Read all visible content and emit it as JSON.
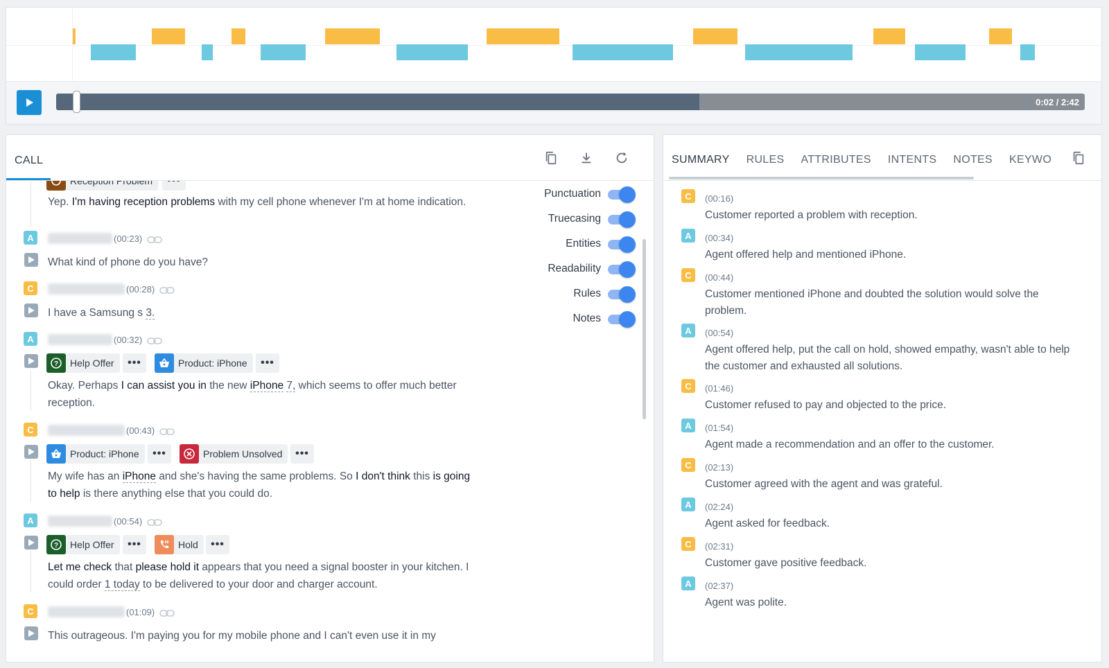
{
  "player": {
    "time": "0:02 / 2:42",
    "progress_fraction": 0.625,
    "handle_fraction": 0.016
  },
  "call": {
    "tab_label": "CALL",
    "partial_chip": "Reception Problem",
    "lines": {
      "l0": {
        "text_pre": "Yep. ",
        "text_bold": "I'm having reception problems",
        "text_post": " with my cell phone whenever I'm at home indication."
      },
      "l1": {
        "badge": "A",
        "time": "(00:23)",
        "text": "What kind of phone do you have?"
      },
      "l2": {
        "badge": "C",
        "time": "(00:28)",
        "text_pre": "I have a Samsung s ",
        "entity": "3."
      },
      "l3": {
        "badge": "A",
        "time": "(00:32)",
        "chip1": "Help Offer",
        "chip2": "Product: iPhone",
        "text_a": "Okay. Perhaps ",
        "text_b": "I can assist you in",
        "text_c": " the new ",
        "entity1": "iPhone",
        "text_d": " ",
        "entity2": "7,",
        "text_e": " which seems to offer much better reception."
      },
      "l4": {
        "badge": "C",
        "time": "(00:43)",
        "chip1": "Product: iPhone",
        "chip2": "Problem Unsolved",
        "text_a": "My wife has an ",
        "entity1": "iPhone",
        "text_b": " and she's having the same problems. So ",
        "bold1": "I don't think",
        "text_c": " this ",
        "bold2": "is going to help",
        "text_d": " is there anything else that you could do."
      },
      "l5": {
        "badge": "A",
        "time": "(00:54)",
        "chip1": "Help Offer",
        "chip2": "Hold",
        "bold1": "Let me check",
        "text_a": " that ",
        "bold2": "please hold it",
        "text_b": " appears that you need a signal booster in your kitchen. I could order ",
        "entity1": "1 today",
        "text_c": " to be delivered to your door and charger account."
      },
      "l6": {
        "badge": "C",
        "time": "(01:09)",
        "text": "This outrageous. I'm paying you for my mobile phone and I can't even use it in my"
      }
    },
    "toggles": [
      {
        "label": "Punctuation",
        "on": true
      },
      {
        "label": "Truecasing",
        "on": true
      },
      {
        "label": "Entities",
        "on": true
      },
      {
        "label": "Readability",
        "on": true
      },
      {
        "label": "Rules",
        "on": true
      },
      {
        "label": "Notes",
        "on": true
      }
    ]
  },
  "summary": {
    "tabs": [
      "SUMMARY",
      "RULES",
      "ATTRIBUTES",
      "INTENTS",
      "NOTES",
      "KEYWORDS"
    ],
    "items": [
      {
        "badge": "C",
        "time": "(00:16)",
        "text": "Customer reported a problem with reception."
      },
      {
        "badge": "A",
        "time": "(00:34)",
        "text": "Agent offered help and mentioned iPhone."
      },
      {
        "badge": "C",
        "time": "(00:44)",
        "text": "Customer mentioned iPhone and doubted the solution would solve the problem."
      },
      {
        "badge": "A",
        "time": "(00:54)",
        "text": "Agent offered help, put the call on hold, showed empathy, wasn't able to help the customer and exhausted all solutions."
      },
      {
        "badge": "C",
        "time": "(01:46)",
        "text": "Customer refused to pay and objected to the price."
      },
      {
        "badge": "A",
        "time": "(01:54)",
        "text": "Agent made a recommendation and an offer to the customer."
      },
      {
        "badge": "C",
        "time": "(02:13)",
        "text": "Customer agreed with the agent and was grateful."
      },
      {
        "badge": "A",
        "time": "(02:24)",
        "text": "Agent asked for feedback."
      },
      {
        "badge": "C",
        "time": "(02:31)",
        "text": "Customer gave positive feedback."
      },
      {
        "badge": "A",
        "time": "(02:37)",
        "text": "Agent was polite."
      }
    ]
  },
  "colors": {
    "customer": "#f9bd45",
    "agent": "#6cc9e0",
    "accent": "#1b8fd6",
    "toggle": "#3d86f0"
  },
  "icons": {
    "play": "play-icon",
    "copy": "copy-icon",
    "download": "download-icon",
    "refresh": "refresh-icon",
    "link": "link-icon",
    "help": "help-offer-icon",
    "basket": "product-basket-icon",
    "unsolved": "problem-unsolved-icon",
    "hold": "hold-phone-icon"
  }
}
